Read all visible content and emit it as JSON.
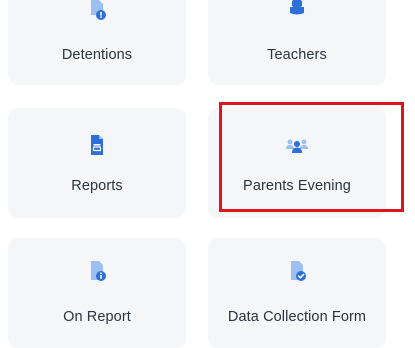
{
  "tiles": [
    {
      "label": "Detentions",
      "icon": "document-alert-icon"
    },
    {
      "label": "Teachers",
      "icon": "teacher-icon"
    },
    {
      "label": "Reports",
      "icon": "report-document-icon"
    },
    {
      "label": "Parents Evening",
      "icon": "parents-group-icon"
    },
    {
      "label": "On Report",
      "icon": "document-info-icon"
    },
    {
      "label": "Data Collection Form",
      "icon": "document-check-icon"
    }
  ],
  "colors": {
    "icon_blue": "#2f6fd8",
    "icon_light_blue": "#9cc0f2",
    "tile_background": "#f4f6f8",
    "label_text": "#2c3440",
    "highlight_border": "#e0141e"
  }
}
